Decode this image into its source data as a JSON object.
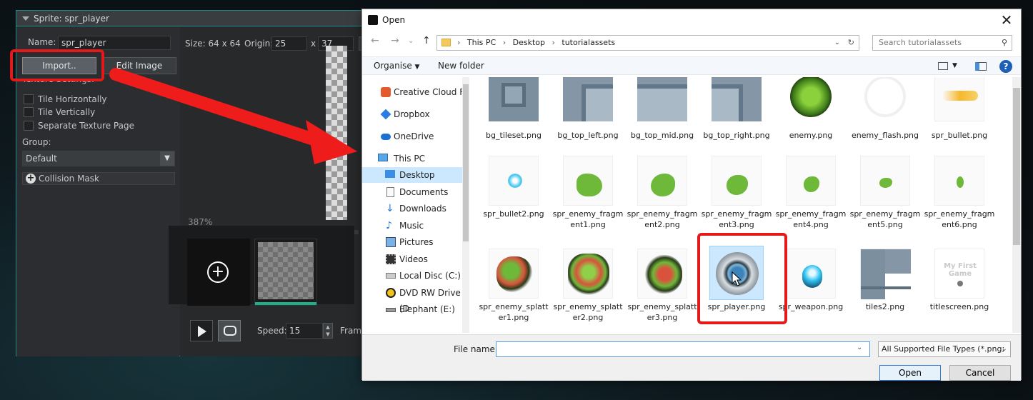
{
  "sprite_window": {
    "title": "Sprite: spr_player",
    "name_label": "Name:",
    "name_value": "spr_player",
    "size_text": "Size: 64 x 64",
    "origin_label": "Origin:",
    "origin_x": "25",
    "origin_sep": "x",
    "origin_y": "37",
    "import_label": "Import..",
    "edit_image_label": "Edit Image",
    "texture_settings_label": "Texture Settings:",
    "tile_h_label": "Tile Horizontally",
    "tile_v_label": "Tile Vertically",
    "separate_page_label": "Separate Texture Page",
    "group_label": "Group:",
    "group_value": "Default",
    "collision_mask_label": "Collision Mask",
    "zoom_text": "387%",
    "speed_label": "Speed:",
    "speed_value": "15",
    "frame_label": "Fram"
  },
  "open_dialog": {
    "title": "Open",
    "breadcrumb": [
      "This PC",
      "Desktop",
      "tutorialassets"
    ],
    "search_placeholder": "Search tutorialassets",
    "organise_label": "Organise",
    "new_folder_label": "New folder",
    "nav_items": [
      {
        "label": "Creative Cloud Fil",
        "icon": "creative-cloud-icon"
      },
      {
        "label": "Dropbox",
        "icon": "dropbox-icon"
      },
      {
        "label": "OneDrive",
        "icon": "onedrive-icon"
      },
      {
        "label": "This PC",
        "icon": "computer-icon"
      },
      {
        "label": "Desktop",
        "icon": "desktop-icon"
      },
      {
        "label": "Documents",
        "icon": "documents-icon"
      },
      {
        "label": "Downloads",
        "icon": "downloads-icon"
      },
      {
        "label": "Music",
        "icon": "music-icon"
      },
      {
        "label": "Pictures",
        "icon": "pictures-icon"
      },
      {
        "label": "Videos",
        "icon": "videos-icon"
      },
      {
        "label": "Local Disc (C:)",
        "icon": "disk-icon"
      },
      {
        "label": "DVD RW Drive (D",
        "icon": "dvd-icon"
      },
      {
        "label": "Elephant (E:)",
        "icon": "drive-icon"
      }
    ],
    "files": [
      {
        "name": "bg_tileset.png"
      },
      {
        "name": "bg_top_left.png"
      },
      {
        "name": "bg_top_mid.png"
      },
      {
        "name": "bg_top_right.png"
      },
      {
        "name": "enemy.png"
      },
      {
        "name": "enemy_flash.png"
      },
      {
        "name": "spr_bullet.png"
      },
      {
        "name": "spr_bullet2.png"
      },
      {
        "name": "spr_enemy_fragment1.png"
      },
      {
        "name": "spr_enemy_fragment2.png"
      },
      {
        "name": "spr_enemy_fragment3.png"
      },
      {
        "name": "spr_enemy_fragment4.png"
      },
      {
        "name": "spr_enemy_fragment5.png"
      },
      {
        "name": "spr_enemy_fragment6.png"
      },
      {
        "name": "spr_enemy_splatter1.png"
      },
      {
        "name": "spr_enemy_splatter2.png"
      },
      {
        "name": "spr_enemy_splatter3.png"
      },
      {
        "name": "spr_player.png"
      },
      {
        "name": "spr_weapon.png"
      },
      {
        "name": "tiles2.png"
      },
      {
        "name": "titlescreen.png"
      }
    ],
    "titlescreen_caption": "My First Game",
    "file_name_label": "File name:",
    "file_name_value": "",
    "file_type_value": "All Supported File Types (*.png;",
    "open_label": "Open",
    "cancel_label": "Cancel",
    "close_glyph": "✕"
  },
  "colors": {
    "highlight": "#e21a1a",
    "accent_teal": "#1d8a86",
    "selection_blue": "#cce8ff"
  }
}
